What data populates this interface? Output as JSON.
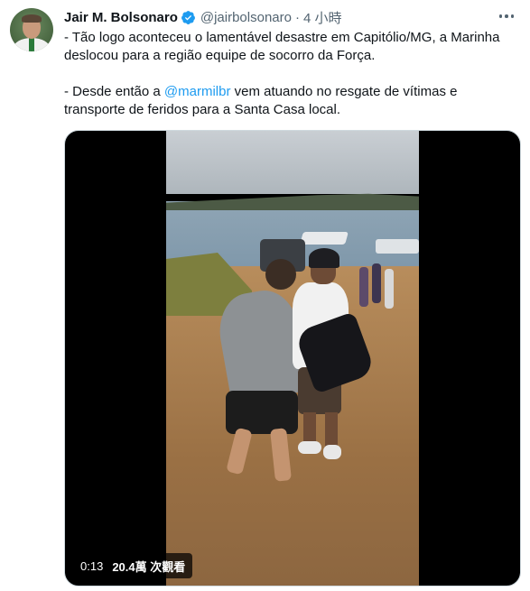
{
  "tweet": {
    "author_name": "Jair M. Bolsonaro",
    "handle": "@jairbolsonaro",
    "separator": "·",
    "time": "4 小時",
    "paragraph1": "- Tão logo aconteceu o lamentável desastre em Capitólio/MG, a Marinha deslocou para a região equipe de socorro da Força.",
    "paragraph2_prefix": "- Desde então a ",
    "paragraph2_mention": "@marmilbr",
    "paragraph2_suffix": " vem atuando no resgate de vítimas e transporte de feridos para a Santa Casa local."
  },
  "video": {
    "duration": "0:13",
    "views": "20.4萬 次觀看"
  },
  "colors": {
    "accent": "#1d9bf0",
    "text": "#0f1419",
    "secondary": "#536471"
  },
  "icons": {
    "verified": "verified-badge-icon",
    "more": "more-options-icon"
  }
}
